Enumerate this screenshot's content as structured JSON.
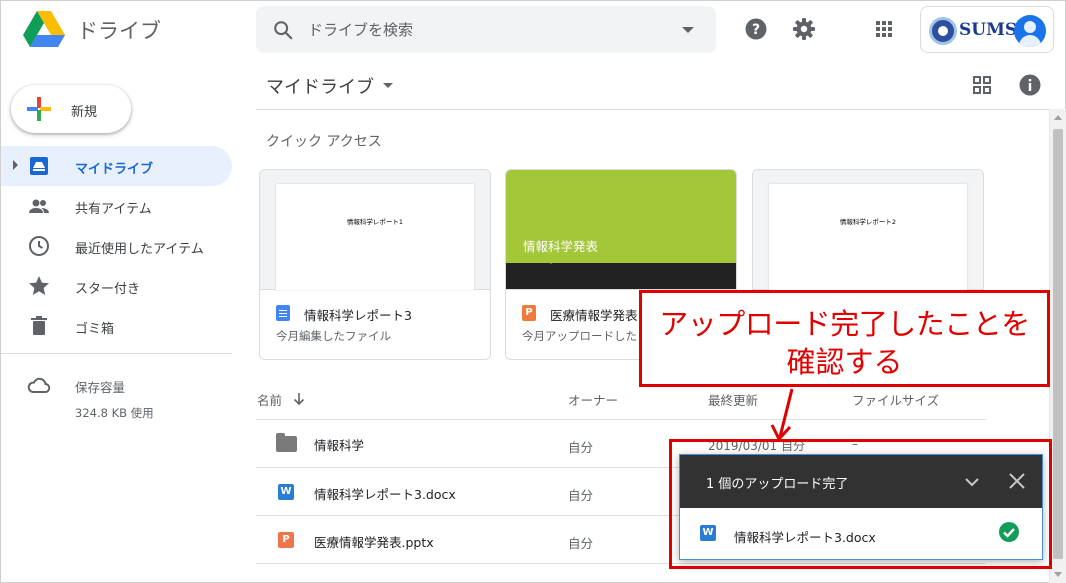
{
  "app": {
    "title": "ドライブ",
    "logo_icon": "google-drive-logo"
  },
  "search": {
    "placeholder": "ドライブを検索"
  },
  "account": {
    "brand": "SUMS"
  },
  "new_button": {
    "label": "新規"
  },
  "sidebar": {
    "items": [
      {
        "label": "マイドライブ",
        "icon": "my-drive-icon",
        "active": true
      },
      {
        "label": "共有アイテム",
        "icon": "shared-icon"
      },
      {
        "label": "最近使用したアイテム",
        "icon": "clock-icon"
      },
      {
        "label": "スター付き",
        "icon": "star-icon"
      },
      {
        "label": "ゴミ箱",
        "icon": "trash-icon"
      }
    ],
    "storage": {
      "label": "保存容量",
      "used": "324.8 KB 使用"
    }
  },
  "main": {
    "title": "マイドライブ",
    "quick_access_label": "クイック アクセス",
    "cards": [
      {
        "thumb_text": "情報科学レポート1",
        "name": "情報科学レポート3",
        "sub": "今月編集したファイル",
        "type": "doc"
      },
      {
        "thumb_text": "情報科学発表",
        "name": "医療情報学発表",
        "sub": "今月アップロードした",
        "type": "ppt"
      },
      {
        "thumb_text": "情報科学レポート2",
        "name": "",
        "sub": "",
        "type": "doc"
      }
    ],
    "columns": {
      "name": "名前",
      "owner": "オーナー",
      "modified": "最終更新",
      "size": "ファイルサイズ"
    },
    "rows": [
      {
        "name": "情報科学",
        "owner": "自分",
        "modified": "2019/03/01 自分",
        "size": "–",
        "type": "folder"
      },
      {
        "name": "情報科学レポート3.docx",
        "owner": "自分",
        "modified": "",
        "size": "",
        "type": "word"
      },
      {
        "name": "医療情報学発表.pptx",
        "owner": "自分",
        "modified": "",
        "size": "",
        "type": "ppt"
      }
    ]
  },
  "annotation": {
    "line1": "アップロード完了したことを",
    "line2": "確認する",
    "color": "#e00000"
  },
  "upload_panel": {
    "title": "1 個のアップロード完了",
    "item_name": "情報科学レポート3.docx",
    "item_icon_letter": "W",
    "ppt_icon_letter": "P"
  }
}
